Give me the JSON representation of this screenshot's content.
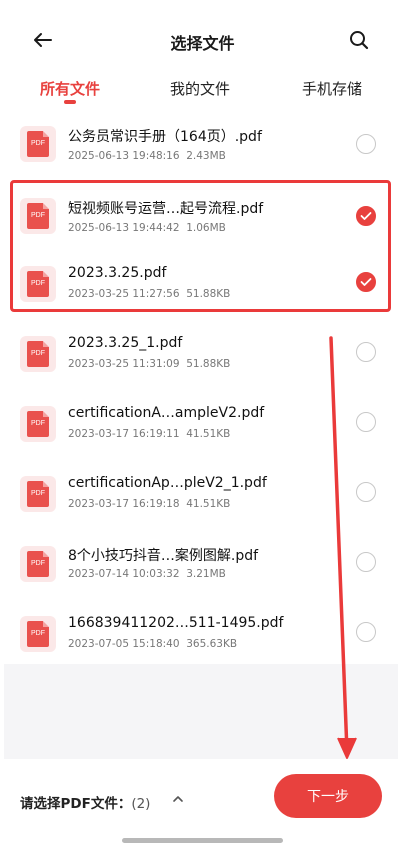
{
  "header": {
    "title": "选择文件",
    "back_icon": "arrow-left-icon",
    "search_icon": "search-icon"
  },
  "tabs": [
    {
      "label": "所有文件",
      "active": true
    },
    {
      "label": "我的文件",
      "active": false
    },
    {
      "label": "手机存储",
      "active": false
    }
  ],
  "files": [
    {
      "name": "公务员常识手册（164页）.pdf",
      "date": "2025-06-13 19:48:16",
      "size": "2.43MB",
      "checked": false,
      "icon_label": "PDF"
    },
    {
      "name": "短视频账号运营…起号流程.pdf",
      "date": "2025-06-13 19:44:42",
      "size": "1.06MB",
      "checked": true,
      "icon_label": "PDF"
    },
    {
      "name": "2023.3.25.pdf",
      "date": "2023-03-25 11:27:56",
      "size": "51.88KB",
      "checked": true,
      "icon_label": "PDF"
    },
    {
      "name": "2023.3.25_1.pdf",
      "date": "2023-03-25 11:31:09",
      "size": "51.88KB",
      "checked": false,
      "icon_label": "PDF"
    },
    {
      "name": "certificationA…ampleV2.pdf",
      "date": "2023-03-17 16:19:11",
      "size": "41.51KB",
      "checked": false,
      "icon_label": "PDF"
    },
    {
      "name": "certificationAp…pleV2_1.pdf",
      "date": "2023-03-17 16:19:18",
      "size": "41.51KB",
      "checked": false,
      "icon_label": "PDF"
    },
    {
      "name": "8个小技巧抖音…案例图解.pdf",
      "date": "2023-07-14 10:03:32",
      "size": "3.21MB",
      "checked": false,
      "icon_label": "PDF"
    },
    {
      "name": "166839411202…511-1495.pdf",
      "date": "2023-07-05 15:18:40",
      "size": "365.63KB",
      "checked": false,
      "icon_label": "PDF"
    }
  ],
  "footer": {
    "label": "请选择PDF文件：",
    "count": "(2)",
    "next_label": "下一步"
  },
  "colors": {
    "accent": "#e8413e",
    "icon_bg": "#fbe8e8",
    "annotation": "#ea3a3a"
  }
}
